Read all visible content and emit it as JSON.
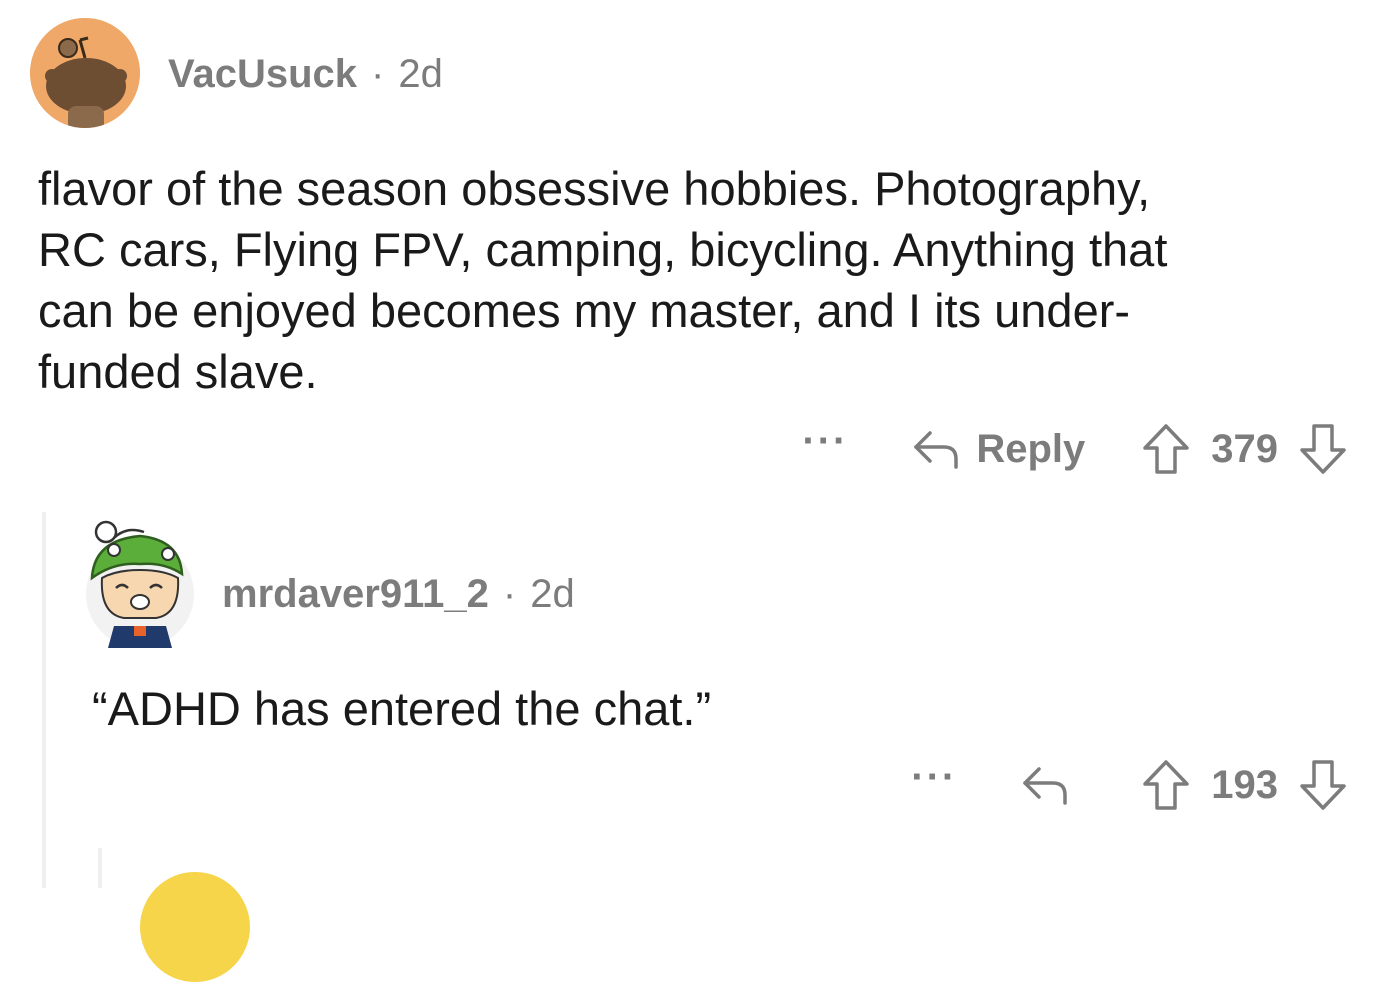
{
  "comments": [
    {
      "username": "VacUsuck",
      "separator": "·",
      "age": "2d",
      "body_lines": [
        "flavor of the season obsessive hobbies.  Photography,",
        "RC cars, Flying FPV, camping, bicycling.  Anything that",
        "can be enjoyed becomes my master, and I its under-",
        "funded slave."
      ],
      "more_label": "···",
      "reply_label": "Reply",
      "vote_count": "379"
    },
    {
      "username": "mrdaver911_2",
      "separator": "·",
      "age": "2d",
      "body_lines": [
        "“ADHD has entered the chat.”"
      ],
      "more_label": "···",
      "vote_count": "193"
    }
  ],
  "colors": {
    "meta_text": "#7c7c7c",
    "body_text": "#1a1a1b",
    "thread_line": "#edeff1",
    "avatar1_bg": "#f0a868",
    "avatar3_bg": "#f7d54a"
  },
  "icons": {
    "avatar1": "reddit-snoo-avatar",
    "avatar2": "frog-hat-avatar",
    "reply": "reply-arrow-icon",
    "upvote": "upvote-arrow-icon",
    "downvote": "downvote-arrow-icon",
    "more": "ellipsis-icon"
  }
}
